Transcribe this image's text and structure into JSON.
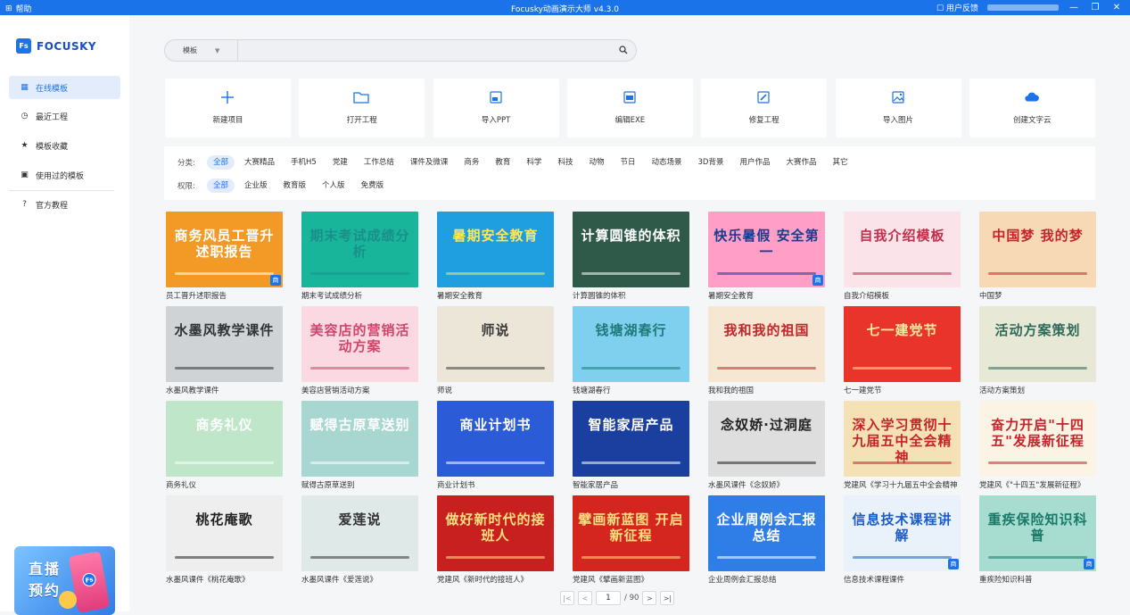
{
  "titlebar": {
    "help_label": "帮助",
    "title": "Focusky动画演示大师 v4.3.0",
    "feedback_label": "用户反馈"
  },
  "sidebar": {
    "brand": "FOCUSKY",
    "logo_badge": "Fs",
    "items": [
      {
        "label": "在线模板",
        "icon": "grid-icon",
        "active": true
      },
      {
        "label": "最近工程",
        "icon": "clock-icon"
      },
      {
        "label": "模板收藏",
        "icon": "star-icon"
      },
      {
        "label": "使用过的模板",
        "icon": "tray-icon"
      },
      {
        "label": "官方教程",
        "icon": "help-circle-icon"
      }
    ],
    "promo": {
      "line1": "直播",
      "line2": "预约",
      "badge": "Fs"
    }
  },
  "search": {
    "scope": "模板",
    "placeholder": ""
  },
  "actions": [
    {
      "label": "新建项目",
      "icon": "plus-icon"
    },
    {
      "label": "打开工程",
      "icon": "folder-icon"
    },
    {
      "label": "导入PPT",
      "icon": "ppt-icon"
    },
    {
      "label": "编辑EXE",
      "icon": "exe-icon"
    },
    {
      "label": "修复工程",
      "icon": "wrench-icon"
    },
    {
      "label": "导入图片",
      "icon": "image-icon"
    },
    {
      "label": "创建文字云",
      "icon": "cloud-icon"
    }
  ],
  "filters": {
    "category_label": "分类:",
    "categories": [
      "全部",
      "大赛精品",
      "手机H5",
      "党建",
      "工作总结",
      "课件及微课",
      "商务",
      "教育",
      "科学",
      "科技",
      "动物",
      "节日",
      "动态场景",
      "3D背景",
      "用户作品",
      "大赛作品",
      "其它"
    ],
    "permission_label": "权限:",
    "permissions": [
      "全部",
      "企业版",
      "教育版",
      "个人版",
      "免费版"
    ]
  },
  "templates": [
    {
      "caption": "员工晋升述职报告",
      "text": "商务风员工晋升述职报告",
      "bg": "#f39a26",
      "fg": "#ffffff",
      "badge": "商"
    },
    {
      "caption": "期末考试成绩分析",
      "text": "期末考试成绩分析",
      "bg": "#19b59a",
      "fg": "#1a8f8a"
    },
    {
      "caption": "暑期安全教育",
      "text": "暑期安全教育",
      "bg": "#1f9fe0",
      "fg": "#ffe65a"
    },
    {
      "caption": "计算圆锥的体积",
      "text": "计算圆锥的体积",
      "bg": "#2f5a4a",
      "fg": "#ffffff"
    },
    {
      "caption": "暑期安全教育",
      "text": "快乐暑假 安全第一",
      "bg": "#ff9fc7",
      "fg": "#1a3c8f",
      "badge": "商"
    },
    {
      "caption": "自我介绍模板",
      "text": "自我介绍模板",
      "bg": "#fbe3ea",
      "fg": "#c0304a"
    },
    {
      "caption": "中国梦",
      "text": "中国梦 我的梦",
      "bg": "#f7d9b6",
      "fg": "#c4242a"
    },
    {
      "caption": "水墨风教学课件",
      "text": "水墨风教学课件",
      "bg": "#cfd3d6",
      "fg": "#333333"
    },
    {
      "caption": "美容店营销活动方案",
      "text": "美容店的营销活动方案",
      "bg": "#fbd9e2",
      "fg": "#d0456a"
    },
    {
      "caption": "师说",
      "text": "师说",
      "bg": "#ebe6d8",
      "fg": "#3a3a3a"
    },
    {
      "caption": "钱塘湖春行",
      "text": "钱塘湖春行",
      "bg": "#7fd0ef",
      "fg": "#1f7a7a"
    },
    {
      "caption": "我和我的祖国",
      "text": "我和我的祖国",
      "bg": "#f6e7d2",
      "fg": "#c4242a"
    },
    {
      "caption": "七一建党节",
      "text": "七一建党节",
      "bg": "#e8342a",
      "fg": "#ffe9a0"
    },
    {
      "caption": "活动方案策划",
      "text": "活动方案策划",
      "bg": "#e7e9d6",
      "fg": "#2e6a5a"
    },
    {
      "caption": "商务礼仪",
      "text": "商务礼仪",
      "bg": "#bfe6c9",
      "fg": "#ffffff"
    },
    {
      "caption": "赋得古原草送别",
      "text": "赋得古原草送别",
      "bg": "#a8d7d2",
      "fg": "#ffffff"
    },
    {
      "caption": "商业计划书",
      "text": "商业计划书",
      "bg": "#2c5bd8",
      "fg": "#ffffff"
    },
    {
      "caption": "智能家居产品",
      "text": "智能家居产品",
      "bg": "#1a3f9e",
      "fg": "#ffffff"
    },
    {
      "caption": "水墨风课件《念奴娇》",
      "text": "念奴娇·过洞庭",
      "bg": "#dedede",
      "fg": "#222222"
    },
    {
      "caption": "党建风《学习十九届五中全会精神",
      "text": "深入学习贯彻十九届五中全会精神",
      "bg": "#f4e1b5",
      "fg": "#c4242a"
    },
    {
      "caption": "党建风《\"十四五\"发展新征程》",
      "text": "奋力开启\"十四五\"发展新征程",
      "bg": "#fbf3e4",
      "fg": "#c4242a"
    },
    {
      "caption": "水墨风课件《桃花庵歌》",
      "text": "桃花庵歌",
      "bg": "#eeeeee",
      "fg": "#222222"
    },
    {
      "caption": "水墨风课件《爱莲说》",
      "text": "爱莲说",
      "bg": "#dfe9e7",
      "fg": "#333333"
    },
    {
      "caption": "党建风《新时代的接班人》",
      "text": "做好新时代的接班人",
      "bg": "#c8201f",
      "fg": "#ffe080"
    },
    {
      "caption": "党建风《擘画新蓝图》",
      "text": "擘画新蓝图 开启新征程",
      "bg": "#d4251f",
      "fg": "#ffe080"
    },
    {
      "caption": "企业周例会汇报总结",
      "text": "企业周例会汇报总结",
      "bg": "#2f7ee8",
      "fg": "#ffffff"
    },
    {
      "caption": "信息技术课程课件",
      "text": "信息技术课程讲解",
      "bg": "#e9f1fb",
      "fg": "#1a5cc8",
      "badge": "商"
    },
    {
      "caption": "重疾险知识科普",
      "text": "重疾保险知识科普",
      "bg": "#a7ddd0",
      "fg": "#1a7a6a",
      "badge": "商"
    }
  ],
  "pager": {
    "current": "1",
    "total": "/ 90",
    "first": "|<",
    "prev": "<",
    "next": ">",
    "last": ">|"
  },
  "colors": {
    "accent": "#1a73e8"
  }
}
